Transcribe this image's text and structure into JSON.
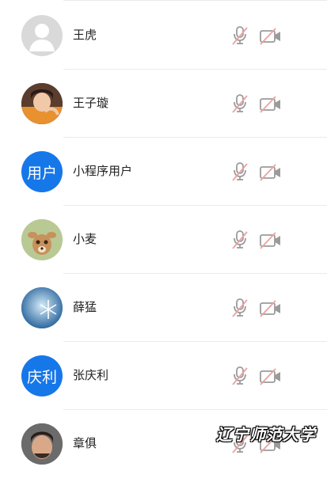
{
  "colors": {
    "accent_blue": "#1677e8",
    "muted_red": "#e8a3a0",
    "icon_gray": "#9b9b9b"
  },
  "participants": [
    {
      "name": "王虎",
      "avatar_type": "default-person",
      "avatar_text": ""
    },
    {
      "name": "王子璇",
      "avatar_type": "photo-portrait",
      "avatar_text": ""
    },
    {
      "name": "小程序用户",
      "avatar_type": "text",
      "avatar_text": "用户"
    },
    {
      "name": "小麦",
      "avatar_type": "photo-cartoon-deer",
      "avatar_text": ""
    },
    {
      "name": "薛猛",
      "avatar_type": "photo-snowflake",
      "avatar_text": ""
    },
    {
      "name": "张庆利",
      "avatar_type": "text",
      "avatar_text": "庆利"
    },
    {
      "name": "章俱",
      "avatar_type": "photo-portrait",
      "avatar_text": ""
    }
  ],
  "watermark": "辽宁师范大学"
}
